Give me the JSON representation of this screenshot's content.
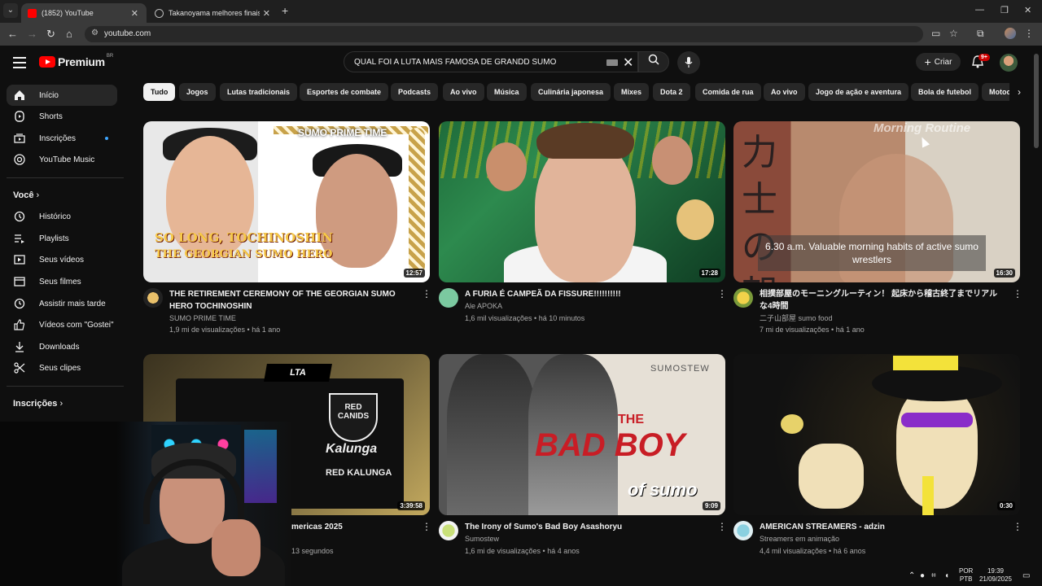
{
  "browser": {
    "tabs": [
      {
        "title": "(1852) YouTube",
        "active": true
      },
      {
        "title": "Takanoyama melhores finais",
        "active": false
      }
    ],
    "url": "youtube.com"
  },
  "masthead": {
    "logo_text": "Premium",
    "logo_country": "BR",
    "search_query": "QUAL FOI A LUTA MAIS FAMOSA DE GRANDD SUMO",
    "create_label": "Criar",
    "notification_count": "9+"
  },
  "sidebar": {
    "main": [
      {
        "label": "Início",
        "icon": "home-icon"
      },
      {
        "label": "Shorts",
        "icon": "shorts-icon"
      },
      {
        "label": "Inscrições",
        "icon": "subscriptions-icon"
      },
      {
        "label": "YouTube Music",
        "icon": "music-icon"
      }
    ],
    "you_header": "Você",
    "you": [
      {
        "label": "Histórico",
        "icon": "history-icon"
      },
      {
        "label": "Playlists",
        "icon": "playlists-icon"
      },
      {
        "label": "Seus vídeos",
        "icon": "your-videos-icon"
      },
      {
        "label": "Seus filmes",
        "icon": "movies-icon"
      },
      {
        "label": "Assistir mais tarde",
        "icon": "watch-later-icon"
      },
      {
        "label": "Vídeos com \"Gostei\"",
        "icon": "like-icon"
      },
      {
        "label": "Downloads",
        "icon": "download-icon"
      },
      {
        "label": "Seus clipes",
        "icon": "clips-icon"
      }
    ],
    "subs_header": "Inscrições"
  },
  "chips": [
    "Tudo",
    "Jogos",
    "Lutas tradicionais",
    "Esportes de combate",
    "Podcasts",
    "Ao vivo",
    "Música",
    "Culinária japonesa",
    "Mixes",
    "Dota 2",
    "Comida de rua",
    "Ao vivo",
    "Jogo de ação e aventura",
    "Bola de futebol",
    "Motoc"
  ],
  "videos": [
    {
      "title": "THE RETIREMENT CEREMONY OF THE GEORGIAN SUMO HERO TOCHINOSHIN",
      "channel": "SUMO PRIME TIME",
      "views": "1,9 mi de visualizações",
      "age": "há 1 ano",
      "duration": "12:57",
      "thumb_text": {
        "tag": "SUMO PRIME TIME",
        "line1": "SO LONG, TOCHINOSHIN",
        "line2": "THE GEORGIAN SUMO HERO"
      }
    },
    {
      "title": "A FURIA É CAMPEÃ DA FISSURE!!!!!!!!!!",
      "channel": "Ale APOKA",
      "views": "1,6 mil visualizações",
      "age": "há 10 minutos",
      "duration": "17:28"
    },
    {
      "title": "相撲部屋のモーニングルーティン！ 起床から稽古終了までリアルな4時間",
      "channel": "二子山部屋 sumo food",
      "views": "7 mi de visualizações",
      "age": "há 1 ano",
      "duration": "16:30",
      "thumb_text": {
        "kanji": "力士の朝",
        "logo": "Morning Routine",
        "subtitle": "6.30 a.m. Valuable morning habits of active sumo wrestlers"
      }
    },
    {
      "title": "mericas 2025",
      "channel": "",
      "views": "",
      "age": "13 segundos",
      "duration": "3:39:58",
      "thumb_text": {
        "league": "LTA",
        "team_short": "RED CANIDS",
        "brand": "Kalunga",
        "team": "RED KALUNGA"
      }
    },
    {
      "title": "The Irony of Sumo's Bad Boy Asashoryu",
      "channel": "Sumostew",
      "views": "1,6 mi de visualizações",
      "age": "há 4 anos",
      "duration": "9:09",
      "thumb_text": {
        "tag": "SUMOSTEW",
        "the": "THE",
        "big": "BAD BOY",
        "small": "of sumo"
      }
    },
    {
      "title": "AMERICAN STREAMERS - adzin",
      "channel": "Streamers em animação",
      "views": "4,4 mil visualizações",
      "age": "há 6 anos",
      "duration": "0:30"
    }
  ],
  "taskbar": {
    "lang1": "POR",
    "lang2": "PTB",
    "time": "19:39",
    "date": "21/09/2025"
  }
}
